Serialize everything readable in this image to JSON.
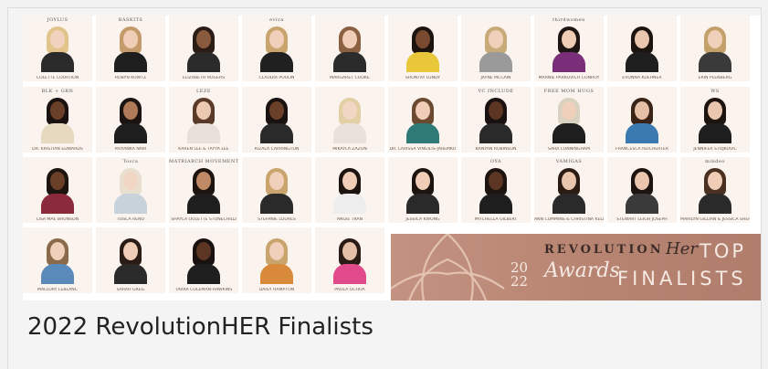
{
  "caption": "2022 RevolutionHER Finalists",
  "banner": {
    "revolution": "REVOLUTION",
    "her": "Her",
    "top": "TOP",
    "year_top": "20",
    "year_bottom": "22",
    "awards": "Awards",
    "finalists": "FINALISTS"
  },
  "finalists": [
    {
      "name": "COLETTE COURTION",
      "brand": "JOYLUS",
      "hair": "#e2c48a",
      "skin": "#f1d2bf",
      "top": "#2a2a2a"
    },
    {
      "name": "ROBYN KOWTZ",
      "brand": "BASKITS",
      "hair": "#c49a6a",
      "skin": "#efcdb7",
      "top": "#1e1e1e"
    },
    {
      "name": "ELIZABETH ROGERS",
      "brand": "",
      "hair": "#2b1d16",
      "skin": "#8a5a3e",
      "top": "#2a2a2a"
    },
    {
      "name": "CLAUDIA POULIN",
      "brand": "eviva",
      "hair": "#c9a46d",
      "skin": "#f0d0ba",
      "top": "#202020"
    },
    {
      "name": "MARGARET COOKE",
      "brand": "",
      "hair": "#8a6040",
      "skin": "#efcdb7",
      "top": "#2b2b2b"
    },
    {
      "name": "SHONTAY LUNDY",
      "brand": "",
      "hair": "#1d1410",
      "skin": "#7a4a30",
      "top": "#e9c73a"
    },
    {
      "name": "JAYNE MCCAIN",
      "brand": "",
      "hair": "#c9ab7a",
      "skin": "#f0d0ba",
      "top": "#9a9a9a"
    },
    {
      "name": "MARNIE PARKOVICH CONROY",
      "brand": "thirdwomen",
      "hair": "#1e1612",
      "skin": "#f0cdb5",
      "top": "#7a2e7a"
    },
    {
      "name": "EVONNA KUEHNER",
      "brand": "",
      "hair": "#1d1410",
      "skin": "#eac6ae",
      "top": "#1e1e1e"
    },
    {
      "name": "ERIN PLENBERG",
      "brand": "",
      "hair": "#c4a06a",
      "skin": "#f0d0ba",
      "top": "#3a3a3a"
    },
    {
      "name": "DR. KRISTIAN EDWARDS",
      "brand": "BLK + GRN",
      "hair": "#1a1210",
      "skin": "#6a4028",
      "top": "#e7d8c0"
    },
    {
      "name": "PRIYANKA NAIR",
      "brand": "",
      "hair": "#1c1410",
      "skin": "#b07a58",
      "top": "#1e1e1e"
    },
    {
      "name": "KAREN LEE & TAYYA LEE",
      "brand": "LEZE",
      "hair": "#5a3a28",
      "skin": "#eccab2",
      "top": "#e8e0d8"
    },
    {
      "name": "RIZALA CARRINGTON",
      "brand": "",
      "hair": "#1a1210",
      "skin": "#6a4028",
      "top": "#2a2a2a"
    },
    {
      "name": "MIKAYLA ZAZON",
      "brand": "",
      "hair": "#e3cfa6",
      "skin": "#f2d6c4",
      "top": "#e8e2da"
    },
    {
      "name": "DR. LARISSA VINGILIS-JAREMKO",
      "brand": "",
      "hair": "#6a4a30",
      "skin": "#efcdb7",
      "top": "#2f7a76"
    },
    {
      "name": "BANYAN ROBINSON",
      "brand": "VC INCLUDE",
      "hair": "#1a1210",
      "skin": "#5c3622",
      "top": "#2a2a2a"
    },
    {
      "name": "SARA CUNNINGHAM",
      "brand": "FREE MOM HUGS",
      "hair": "#d9d2c0",
      "skin": "#f0d0ba",
      "top": "#1e1e1e"
    },
    {
      "name": "FRANCESCA REICHERTER",
      "brand": "",
      "hair": "#3a2418",
      "skin": "#e6c0a6",
      "top": "#3a7ab0"
    },
    {
      "name": "JENNIFER STOJKOVIC",
      "brand": "WS",
      "hair": "#1d1410",
      "skin": "#eac6ae",
      "top": "#1e1e1e"
    },
    {
      "name": "LISA MAE BRUNSON",
      "brand": "",
      "hair": "#1d1410",
      "skin": "#6a4028",
      "top": "#8a2a3a"
    },
    {
      "name": "TOSCA RENO",
      "brand": "Tosca",
      "hair": "#e8dfcf",
      "skin": "#f2d6c4",
      "top": "#c8d2da"
    },
    {
      "name": "SHAYLA OULETTE STONECHILD",
      "brand": "MATRIARCH MOVEMENT",
      "hair": "#1d1410",
      "skin": "#c08a66",
      "top": "#1e1e1e"
    },
    {
      "name": "STEFANIE LOURES",
      "brand": "",
      "hair": "#c9a46d",
      "skin": "#f0d0ba",
      "top": "#2a2a2a"
    },
    {
      "name": "ANGIE TRAN",
      "brand": "",
      "hair": "#1d1410",
      "skin": "#efcdb7",
      "top": "#ededed"
    },
    {
      "name": "JESSICA KWONG",
      "brand": "",
      "hair": "#1d1410",
      "skin": "#efcdb7",
      "top": "#2a2a2a"
    },
    {
      "name": "MITCHELLA GILBERT",
      "brand": "OYA",
      "hair": "#1d1410",
      "skin": "#5c3622",
      "top": "#1e1e1e"
    },
    {
      "name": "ANN CUMMINS & CHRISTINA KELMON",
      "brand": "VAMIGAS",
      "hair": "#2a1c14",
      "skin": "#eac6ae",
      "top": "#2a2a2a"
    },
    {
      "name": "STEWART LEIGH JOSEPH",
      "brand": "",
      "hair": "#1d1410",
      "skin": "#eac6ae",
      "top": "#3a3a3a"
    },
    {
      "name": "MARILYN GILLIAN & JESSICA SHEPARD",
      "brand": "mindeo",
      "hair": "#4a3020",
      "skin": "#efcdb7",
      "top": "#2a2a2a"
    },
    {
      "name": "MALLORY LEBLANC",
      "brand": "",
      "hair": "#8a6a4a",
      "skin": "#f0d0ba",
      "top": "#5a8aba"
    },
    {
      "name": "SARAH GREG",
      "brand": "",
      "hair": "#2a1c14",
      "skin": "#efcdb7",
      "top": "#2a2a2a"
    },
    {
      "name": "TARRA COLEMAN-HAWKINS",
      "brand": "",
      "hair": "#1a1210",
      "skin": "#5c3622",
      "top": "#1e1e1e"
    },
    {
      "name": "DAISY HAMPTON",
      "brand": "",
      "hair": "#c9a46d",
      "skin": "#f0d0ba",
      "top": "#d88a3a"
    },
    {
      "name": "PAOLA OCHOA",
      "brand": "",
      "hair": "#2a1c14",
      "skin": "#e6c0a6",
      "top": "#e04a8a"
    }
  ]
}
